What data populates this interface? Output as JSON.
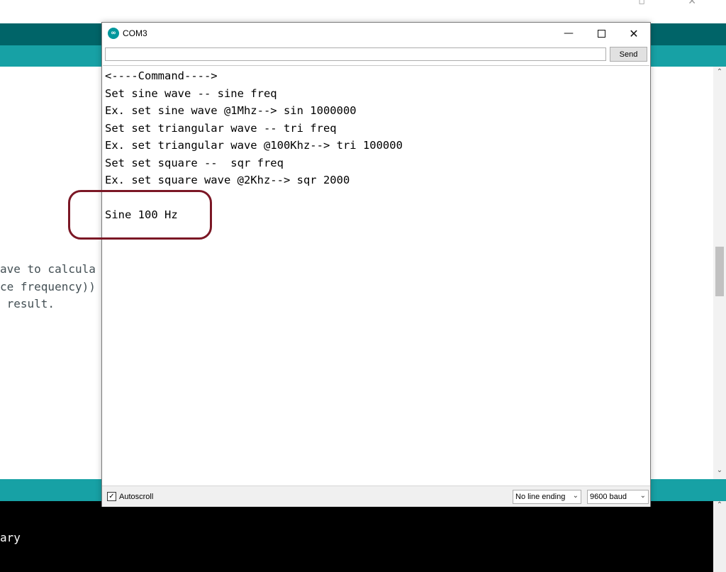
{
  "background_ide": {
    "code_lines": [
      "ave to calcula",
      "ce frequency))",
      " result."
    ],
    "console_text": "ary",
    "icons": {
      "serial_monitor": "magnifier-icon",
      "tab_menu": "chevron-down-icon"
    }
  },
  "serial_monitor": {
    "title": "COM3",
    "window_buttons": {
      "minimize": "—",
      "close": "✕"
    },
    "input": {
      "value": "",
      "placeholder": ""
    },
    "send_label": "Send",
    "output_lines": [
      "<----Command---->",
      "Set sine wave -- sine freq",
      "Ex. set sine wave @1Mhz--> sin 1000000",
      "Set set triangular wave -- tri freq",
      "Ex. set triangular wave @100Khz--> tri 100000",
      "Set set square --  sqr freq",
      "Ex. set square wave @2Khz--> sqr 2000",
      "",
      "Sine 100 Hz"
    ],
    "autoscroll_label": "Autoscroll",
    "autoscroll_checked": true,
    "line_ending": "No line ending",
    "baud_rate": "9600 baud"
  },
  "colors": {
    "toolbar": "#006468",
    "tabbar": "#17a1a5",
    "highlight": "#7b1725"
  }
}
